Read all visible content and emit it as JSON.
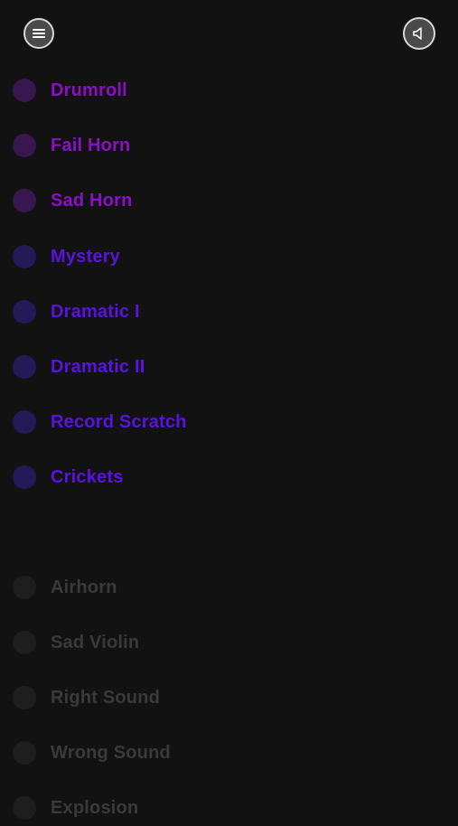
{
  "header": {
    "menu_icon": "hamburger-menu-icon",
    "sound_icon": "speaker-icon"
  },
  "colors": {
    "background": "#121212",
    "purple_dot": "#3a1650",
    "purple_text": "#8a10c8",
    "blue_dot": "#241a58",
    "blue_text": "#5a12e0",
    "gray_dot": "#1e1e1e",
    "gray_text": "#3a3a3a"
  },
  "sounds": [
    {
      "label": "Drumroll",
      "group": "purple"
    },
    {
      "label": "Fail Horn",
      "group": "purple"
    },
    {
      "label": "Sad Horn",
      "group": "purple"
    },
    {
      "label": "Mystery",
      "group": "blue"
    },
    {
      "label": "Dramatic I",
      "group": "blue"
    },
    {
      "label": "Dramatic II",
      "group": "blue"
    },
    {
      "label": "Record Scratch",
      "group": "blue"
    },
    {
      "label": "Crickets",
      "group": "blue"
    },
    {
      "label": "Airhorn",
      "group": "gray"
    },
    {
      "label": "Sad Violin",
      "group": "gray"
    },
    {
      "label": "Right Sound",
      "group": "gray"
    },
    {
      "label": "Wrong Sound",
      "group": "gray"
    },
    {
      "label": "Explosion",
      "group": "gray"
    }
  ]
}
